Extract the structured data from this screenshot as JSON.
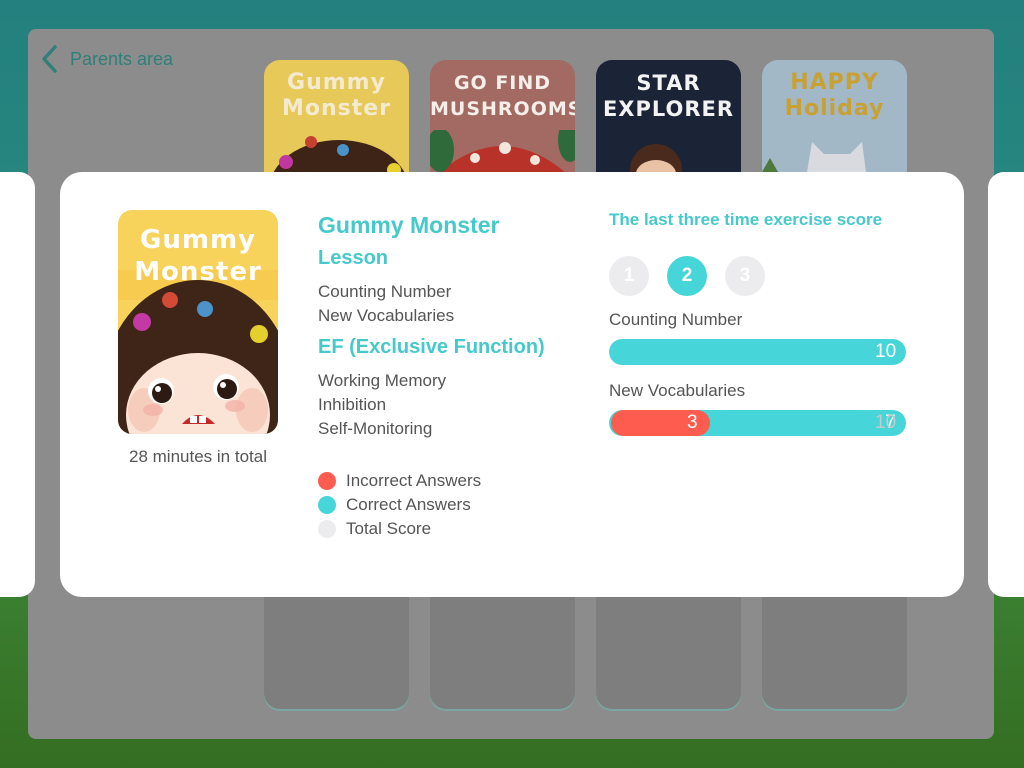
{
  "nav": {
    "back_label": "Parents area"
  },
  "background_games": [
    {
      "title_lines": [
        "Gummy",
        "Monster"
      ],
      "bg": "#e7c95a",
      "text_color": "#f3ead0"
    },
    {
      "title_lines": [
        "GO FIND",
        "MUSHROOMS"
      ],
      "bg": "#a36a63",
      "text_color": "#f5efe9"
    },
    {
      "title_lines": [
        "STAR",
        "EXPLORER"
      ],
      "bg": "#1b2336",
      "text_color": "#f3f3f3"
    },
    {
      "title_lines": [
        "HAPPY",
        "Holiday"
      ],
      "bg": "#a3b8c6",
      "text_color": "#c9a032"
    }
  ],
  "detail": {
    "cover_title_lines": [
      "Gummy",
      "Monster"
    ],
    "duration": "28 minutes in total",
    "game_title": "Gummy Monster",
    "lesson_heading": "Lesson",
    "lessons": [
      "Counting Number",
      "New Vocabularies"
    ],
    "ef_heading": "EF (Exclusive Function)",
    "ef_items": [
      "Working Memory",
      "Inhibition",
      "Self-Monitoring"
    ]
  },
  "legend": [
    {
      "label": "Incorrect Answers",
      "color": "#fd5c4f"
    },
    {
      "label": "Correct Answers",
      "color": "#46d5d9"
    },
    {
      "label": "Total Score",
      "color": "#ececef"
    }
  ],
  "scores": {
    "title": "The last three time exercise score",
    "attempts": [
      "1",
      "2",
      "3"
    ],
    "active_attempt": "2",
    "metrics": [
      {
        "label": "Counting Number",
        "incorrect": 0,
        "correct": 10,
        "total": 10,
        "correct_label": "10"
      },
      {
        "label": "New Vocabularies",
        "incorrect": 3,
        "correct": 7,
        "total": 10,
        "incorrect_label": "3",
        "correct_label": "7",
        "total_label": "10"
      }
    ]
  },
  "colors": {
    "accent": "#46c9cb",
    "incorrect": "#fd5c4f",
    "correct": "#46d5d9",
    "track": "#ececef"
  }
}
